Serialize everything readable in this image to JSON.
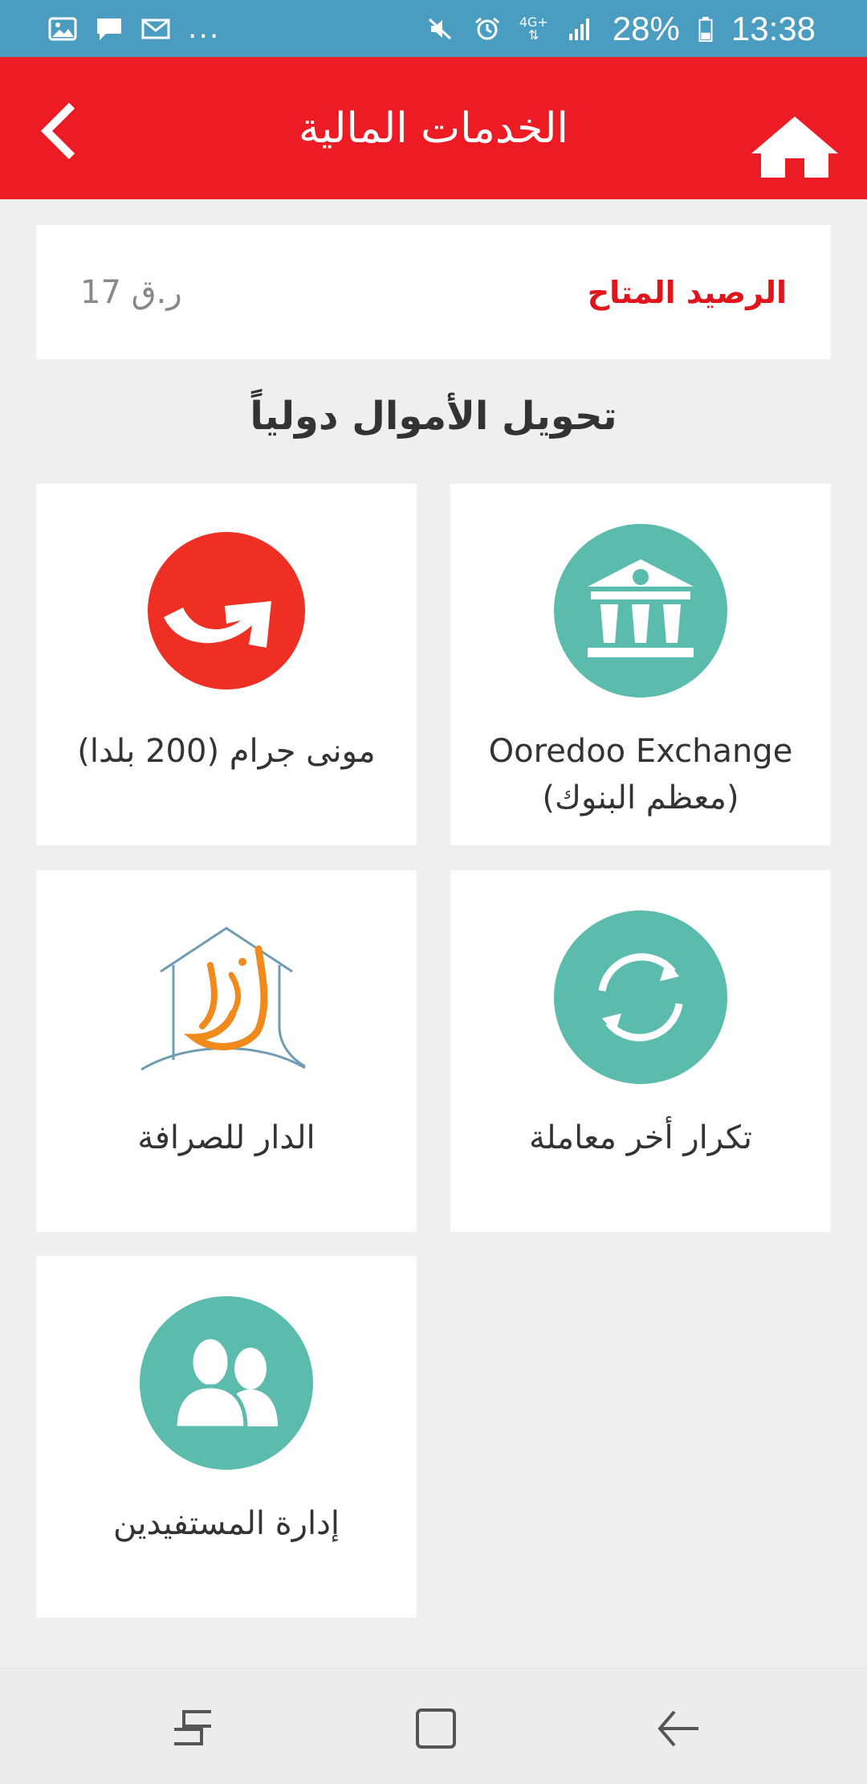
{
  "status_bar": {
    "left_icons": [
      "gallery-icon",
      "message-icon",
      "mail-icon"
    ],
    "overflow": "...",
    "network": "4G+",
    "battery": "28%",
    "time": "13:38"
  },
  "app_bar": {
    "title": "الخدمات المالية",
    "back_icon": "chevron-left-icon",
    "home_icon": "home-icon"
  },
  "balance": {
    "label": "الرصيد المتاح",
    "value": "ر.ق 17"
  },
  "section": {
    "title": "تحويل الأموال دولياً"
  },
  "tiles": [
    {
      "id": "ooredoo-exchange",
      "icon": "bank-icon",
      "line1": "Ooredoo Exchange",
      "line2": "(معظم البنوك)"
    },
    {
      "id": "moneygram",
      "icon": "moneygram-logo",
      "line1": "مونى جرام (200 بلدا)",
      "line2": ""
    },
    {
      "id": "repeat-last",
      "icon": "refresh-icon",
      "line1": "تكرار أخر معاملة",
      "line2": ""
    },
    {
      "id": "al-dar",
      "icon": "al-dar-logo",
      "line1": "الدار للصرافة",
      "line2": ""
    },
    {
      "id": "beneficiaries",
      "icon": "users-icon",
      "line1": "إدارة المستفيدين",
      "line2": ""
    }
  ],
  "colors": {
    "status_bar": "#4a9dc1",
    "app_bar": "#ed1c24",
    "teal": "#5bbcad",
    "moneygram_red": "#ee2f24",
    "balance_label": "#e0141d"
  },
  "nav_bar": {
    "buttons": [
      "recent-apps-icon",
      "home-square-icon",
      "back-arrow-icon"
    ]
  }
}
